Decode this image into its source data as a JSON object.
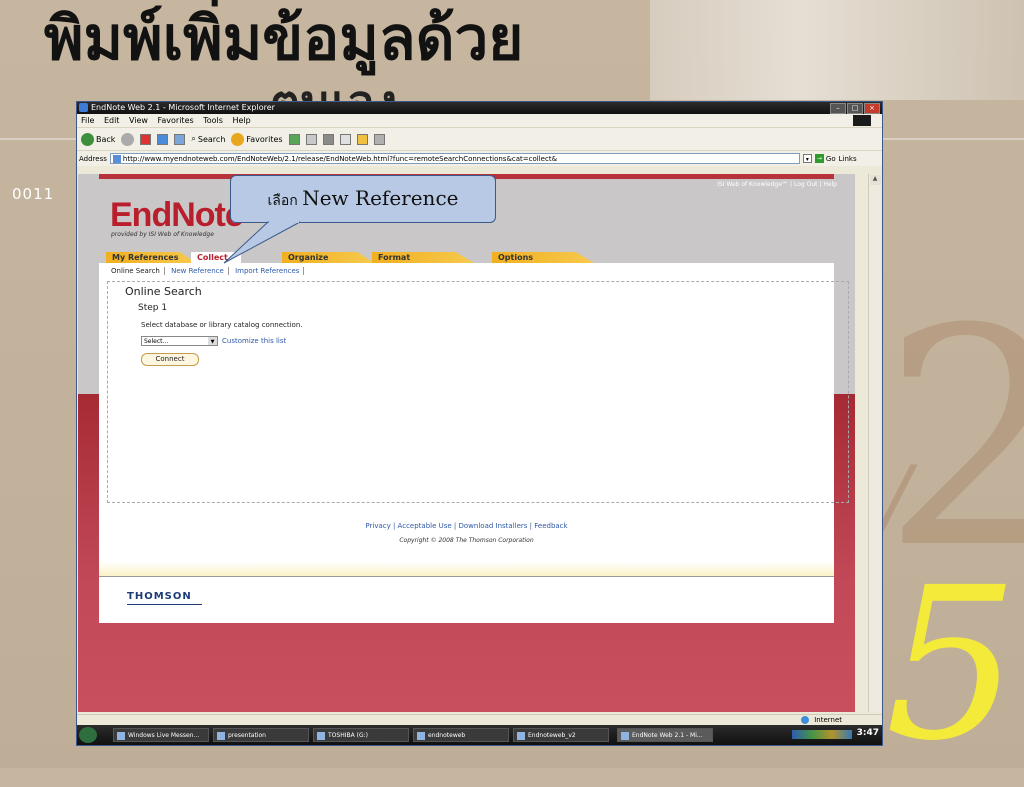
{
  "slide": {
    "title_line1": "พิมพ์เพิ่มข้อมูลด้วย",
    "title_line2": "ตนเอง",
    "slide_number": "0011",
    "deco_digit_top": "2",
    "deco_digit_bottom": "5",
    "deco_slash": "/"
  },
  "browser": {
    "title": "EndNote Web 2.1 - Microsoft Internet Explorer",
    "menu": [
      "File",
      "Edit",
      "View",
      "Favorites",
      "Tools",
      "Help"
    ],
    "toolbar": {
      "back": "Back",
      "search": "Search",
      "favorites": "Favorites"
    },
    "address_label": "Address",
    "url": "http://www.myendnoteweb.com/EndNoteWeb/2.1/release/EndNoteWeb.html?func=remoteSearchConnections&cat=collect&",
    "go_label": "Go",
    "links_label": "Links",
    "status_zone": "Internet"
  },
  "endnote": {
    "header_links": "ISI Web of Knowledge℠  |  Log Out  |  Help",
    "logo": "EndNote",
    "logo_sub": "provided by ISI Web of Knowledge",
    "tabs": [
      "My References",
      "Collect",
      "Organize",
      "Format",
      "Options"
    ],
    "subnav": {
      "online_search": "Online Search",
      "new_reference": "New Reference",
      "import_references": "Import References"
    },
    "panel": {
      "heading": "Online Search",
      "step": "Step 1",
      "instruction": "Select database or library catalog connection.",
      "select_value": "Select...",
      "customize_link": "Customize this list",
      "connect_button": "Connect"
    },
    "footer": {
      "links": "Privacy  | Acceptable Use  | Download Installers  | Feedback",
      "copyright": "Copyright © 2008 The Thomson Corporation"
    },
    "brand": "THOMSON"
  },
  "taskbar": {
    "tasks": [
      "Windows Live Messen...",
      "presentation",
      "TOSHIBA (G:)",
      "endnoteweb",
      "Endnoteweb_v2",
      "EndNote Web 2.1 - Mi..."
    ],
    "clock": "3:47"
  },
  "callout": {
    "prefix": "เลือก ",
    "text": "New Reference"
  },
  "colors": {
    "accent_red": "#b81e2b",
    "tab_orange": "#f1b01f",
    "link_blue": "#2f5aa8",
    "callout_fill": "#b7c9e4"
  }
}
